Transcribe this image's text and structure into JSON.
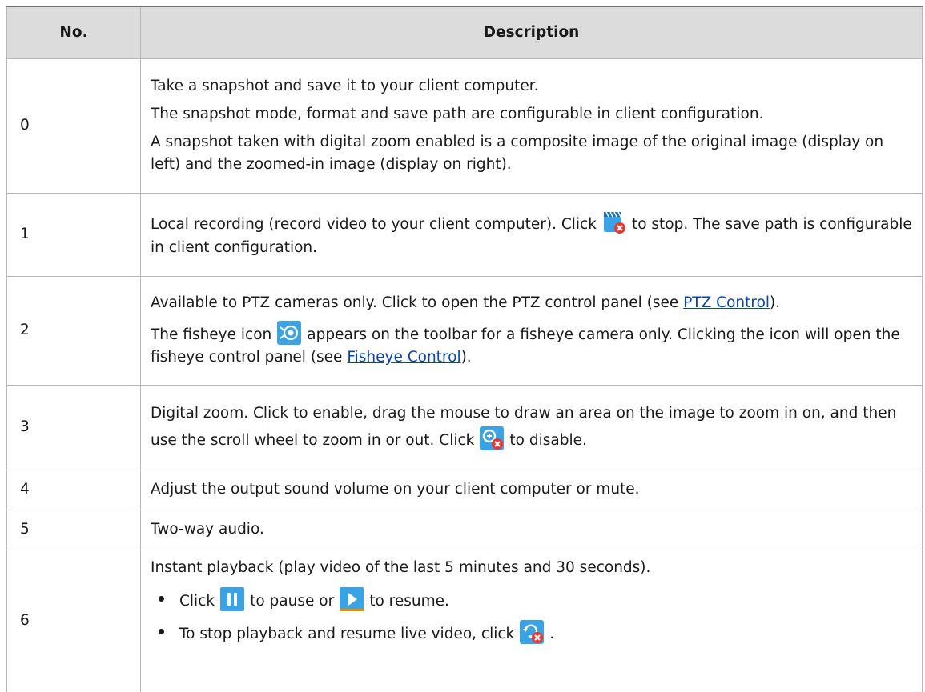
{
  "table": {
    "headers": {
      "no": "No.",
      "description": "Description"
    },
    "rows": [
      {
        "no": "0",
        "lines": [
          "Take a snapshot and save it to your client computer.",
          "The snapshot mode, format and save path are configurable in client configuration.",
          "A snapshot taken with digital zoom enabled is a composite image of the original image (display on left) and the zoomed-in image (display on right)."
        ]
      },
      {
        "no": "1",
        "before_icon": "Local recording (record video to your client computer). Click",
        "icon": "stop-recording-icon",
        "after_icon": "to stop. The save path is configurable in client configuration."
      },
      {
        "no": "2",
        "line1_before_link": "Available to PTZ cameras only. Click to open the PTZ control panel (see ",
        "line1_link": "PTZ Control",
        "line1_after_link": ").",
        "line2_before_icon": "The fisheye icon",
        "line2_icon": "fisheye-icon",
        "line2_after_icon": "appears on the toolbar for a fisheye camera only. Clicking the icon will open the fisheye control panel (see ",
        "line2_link": "Fisheye Control",
        "line2_after_link": ")."
      },
      {
        "no": "3",
        "before_icon": "Digital zoom. Click to enable, drag the mouse to draw an area on the image to zoom in on, and then use the scroll wheel to zoom in or out. Click",
        "icon": "disable-zoom-icon",
        "after_icon": "to disable."
      },
      {
        "no": "4",
        "text": "Adjust the output sound volume on your client computer or mute."
      },
      {
        "no": "5",
        "text": "Two-way audio."
      },
      {
        "no": "6",
        "intro": "Instant playback (play video of the last 5 minutes and 30 seconds).",
        "bullet1": {
          "click": "Click",
          "pause_icon": "pause-icon",
          "middle": "to pause or",
          "play_icon": "play-icon",
          "end": "to resume."
        },
        "bullet2": {
          "text": "To stop playback and resume live video, click",
          "icon": "stop-playback-icon",
          "end": "."
        }
      }
    ]
  },
  "colors": {
    "header_bg": "#dcdcdc",
    "border": "#b8b8b8",
    "link": "#0645ad",
    "icon_blue": "#3aa3e6",
    "icon_red": "#e53935"
  }
}
